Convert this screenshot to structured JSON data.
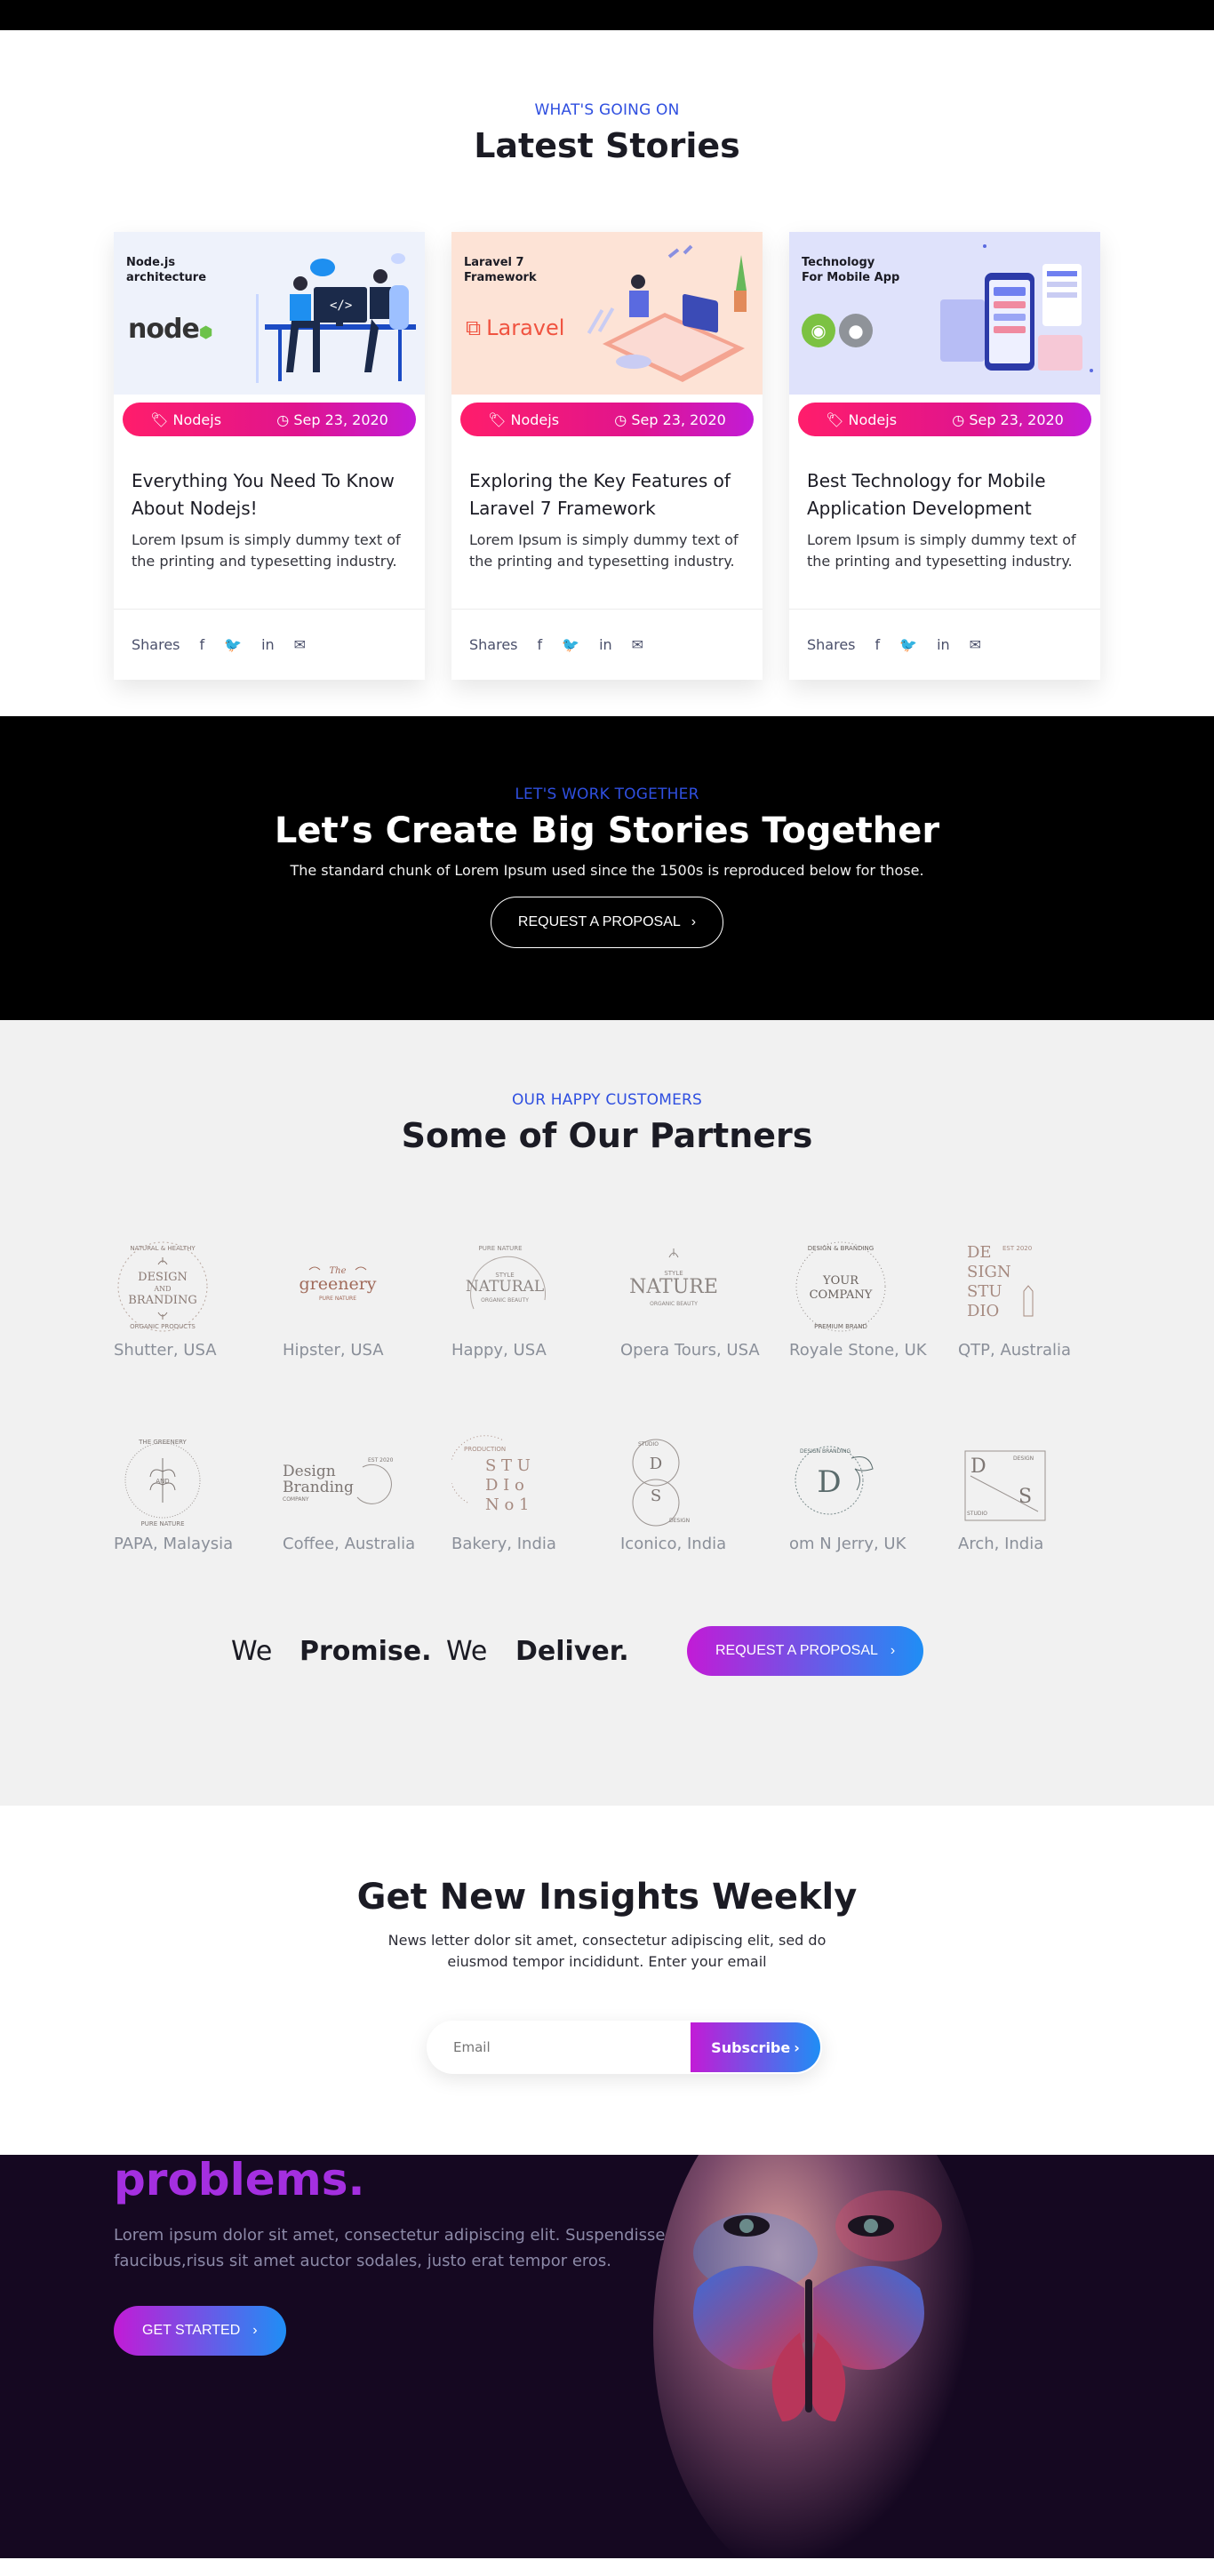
{
  "stories": {
    "eyebrow": "WHAT'S GOING ON",
    "title": "Latest Stories",
    "cards": [
      {
        "image_title_line1": "Node.js",
        "image_title_line2": "architecture",
        "image_logo_text": "node",
        "image_bg": "#eef2fb",
        "tag": "Nodejs",
        "date": "Sep 23, 2020",
        "title_line1": "Everything You Need To Know",
        "title_line2": "About Nodejs!",
        "text_line1": "Lorem Ipsum is simply dummy text of",
        "text_line2": "the printing and typesetting industry.",
        "shares_label": "Shares"
      },
      {
        "image_title_line1": "Laravel 7",
        "image_title_line2": "Framework",
        "image_logo_text": "Laravel",
        "image_bg": "#fde3d6",
        "tag": "Nodejs",
        "date": "Sep 23, 2020",
        "title_line1": "Exploring the Key Features of",
        "title_line2": "Laravel 7 Framework",
        "text_line1": "Lorem Ipsum is simply dummy text of",
        "text_line2": "the printing and typesetting industry.",
        "shares_label": "Shares"
      },
      {
        "image_title_line1": "Technology",
        "image_title_line2": "For Mobile App",
        "image_logo_text": "",
        "image_bg": "#dfe2fb",
        "tag": "Nodejs",
        "date": "Sep 23, 2020",
        "title_line1": "Best Technology for Mobile",
        "title_line2": "Application Development",
        "text_line1": "Lorem Ipsum is simply dummy text of",
        "text_line2": "the printing and typesetting industry.",
        "shares_label": "Shares"
      }
    ],
    "share_icons": [
      "facebook-icon",
      "twitter-icon",
      "linkedin-icon",
      "envelope-icon"
    ]
  },
  "work": {
    "eyebrow": "LET'S WORK TOGETHER",
    "title": "Let’s Create Big Stories Together",
    "subtitle": "The standard chunk of Lorem Ipsum used since the 1500s is reproduced below for those.",
    "button": "REQUEST A PROPOSAL"
  },
  "partners": {
    "eyebrow": "OUR HAPPY CUSTOMERS",
    "title": "Some of Our Partners",
    "logos": [
      {
        "caption": "Shutter, USA",
        "mark_top": "DESIGN",
        "mark_mid": "AND",
        "mark_bottom": "BRANDING",
        "arc_top": "NATURAL & HEALTHY",
        "arc_bottom": "ORGANIC PRODUCTS"
      },
      {
        "caption": "Hipster, USA",
        "mark_top": "The",
        "mark_mid": "greenery",
        "mark_bottom": "PURE NATURE"
      },
      {
        "caption": "Happy, USA",
        "mark_top": "STYLE",
        "mark_mid": "NATURAL",
        "mark_bottom": "ORGANIC BEAUTY",
        "arc_top": "PURE NATURE"
      },
      {
        "caption": "Opera Tours, USA",
        "mark_top": "STYLE",
        "mark_mid": "NATURE",
        "mark_bottom": "ORGANIC BEAUTY"
      },
      {
        "caption": "Royale Stone, UK",
        "mark_top": "YOUR",
        "mark_mid": "COMPANY",
        "mark_bottom": "",
        "arc_top": "DESIGN & BRANDING",
        "arc_bottom": "PREMIUM BRAND"
      },
      {
        "caption": "QTP, Australia",
        "mark_top": "DE",
        "mark_mid": "SIGN",
        "mark_bottom": "STU",
        "mark_extra": "DIO",
        "mark_est": "EST 2020"
      },
      {
        "caption": "PAPA, Malaysia",
        "mark_top": "AND",
        "mark_mid": "",
        "mark_bottom": "",
        "arc_top": "THE GREENERY",
        "arc_bottom": "PURE NATURE"
      },
      {
        "caption": "Coffee, Australia",
        "mark_top": "Design",
        "mark_mid": "Branding",
        "mark_bottom": "COMPANY",
        "arc_top": "EST 2020"
      },
      {
        "caption": "Bakery, India",
        "mark_top": "S T U",
        "mark_mid": "D I o",
        "mark_bottom": "N o 1",
        "arc_top": "PRODUCTION"
      },
      {
        "caption": "Iconico, India",
        "mark_top": "D",
        "mark_mid": "S",
        "mark_bottom": "",
        "arc_top": "STUDIO",
        "arc_bottom": "DESIGN"
      },
      {
        "caption": "om N Jerry, UK",
        "mark_top": "D",
        "mark_mid": "",
        "mark_bottom": "",
        "arc_top": "DESIGN BRANDING"
      },
      {
        "caption": "Arch, India",
        "mark_top": "D",
        "mark_mid": "S",
        "mark_bottom": "STUDIO",
        "mark_extra": "DESIGN"
      }
    ],
    "promise": {
      "w1": "We",
      "w2": "Promise.",
      "w3": "We",
      "w4": "Deliver."
    },
    "button": "REQUEST A PROPOSAL"
  },
  "insights": {
    "title": "Get New Insights Weekly",
    "text_line1": "News letter dolor sit amet, consectetur adipiscing elit, sed do",
    "text_line2": "eiusmod tempor incididunt. Enter your email",
    "email_placeholder": "Email",
    "button": "Subscribe"
  },
  "hero": {
    "title": "problems.",
    "text_line1": "Lorem ipsum dolor sit amet, consectetur adipiscing elit. Suspendisse",
    "text_line2": "faucibus,risus sit amet auctor sodales, justo erat tempor eros.",
    "button": "GET STARTED"
  },
  "colors": {
    "accent_blue": "#2f4fe0",
    "badge_pink": "#ff1d6b",
    "gradient_purple": "#c21bd6",
    "gradient_blue": "#1f8ef5",
    "hero_bg": "#150821"
  }
}
